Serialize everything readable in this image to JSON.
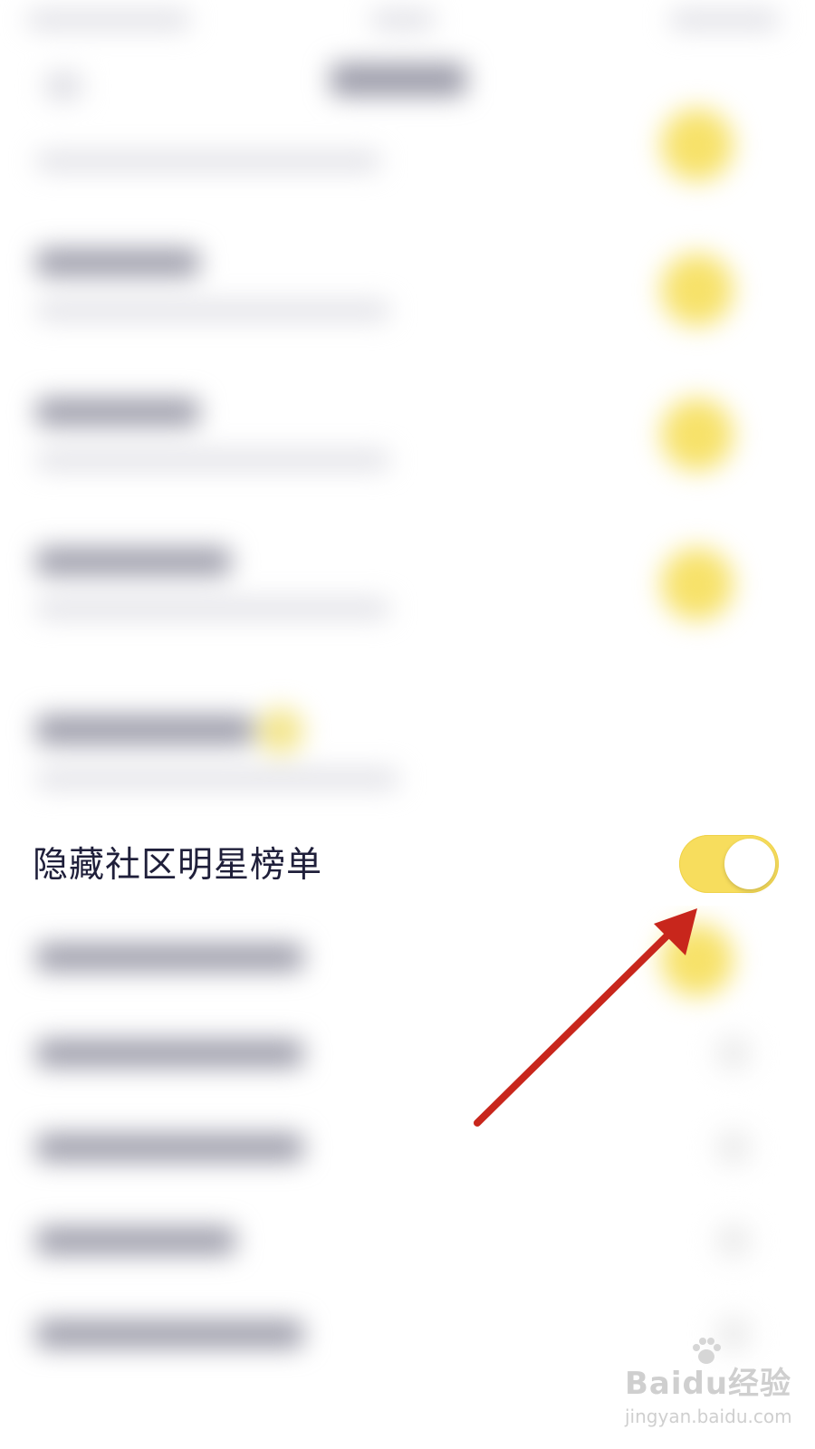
{
  "settings": {
    "hide_star_ranking": {
      "label": "隐藏社区明星榜单",
      "state": "on"
    }
  },
  "colors": {
    "toggle_on": "#f7dd5d",
    "label_text": "#1f1f3a",
    "annotation_arrow": "#c8261c"
  },
  "watermark": {
    "main": "Baidu经验",
    "sub": "jingyan.baidu.com"
  }
}
